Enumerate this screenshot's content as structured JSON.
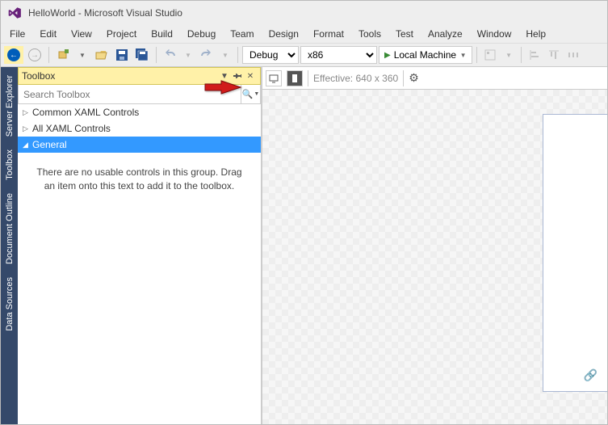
{
  "title": "HelloWorld - Microsoft Visual Studio",
  "menu": [
    "File",
    "Edit",
    "View",
    "Project",
    "Build",
    "Debug",
    "Team",
    "Design",
    "Format",
    "Tools",
    "Test",
    "Analyze",
    "Window",
    "Help"
  ],
  "toolbar": {
    "config": "Debug",
    "platform": "x86",
    "run_label": "Local Machine"
  },
  "side_tabs": [
    "Server Explorer",
    "Toolbox",
    "Document Outline",
    "Data Sources"
  ],
  "toolbox": {
    "title": "Toolbox",
    "search_placeholder": "Search Toolbox",
    "groups": [
      "Common XAML Controls",
      "All XAML Controls",
      "General"
    ],
    "empty_text": "There are no usable controls in this group. Drag an item onto this text to add it to the toolbox."
  },
  "designer": {
    "effective_label": "Effective: 640 x 360"
  }
}
